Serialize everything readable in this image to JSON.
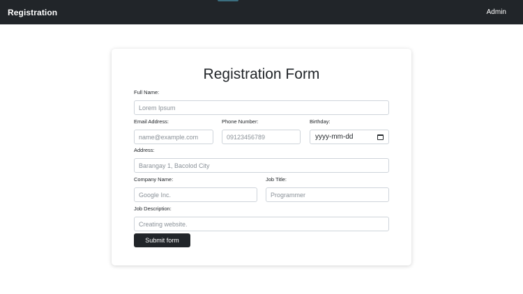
{
  "navbar": {
    "brand": "Registration",
    "admin_link": "Admin"
  },
  "form": {
    "title": "Registration Form",
    "full_name": {
      "label": "Full Name:",
      "placeholder": "Lorem Ipsum"
    },
    "email": {
      "label": "Email Address:",
      "placeholder": "name@example.com"
    },
    "phone": {
      "label": "Phone Number:",
      "placeholder": "09123456789"
    },
    "birthday": {
      "label": "Birthday:",
      "value": "yyyy-mm-dd",
      "icon": "calendar-icon"
    },
    "address": {
      "label": "Address:",
      "placeholder": "Barangay 1, Bacolod City"
    },
    "company": {
      "label": "Company Name:",
      "placeholder": "Google Inc."
    },
    "job_title": {
      "label": "Job Title:",
      "placeholder": "Programmer"
    },
    "job_description": {
      "label": "Job Description:",
      "placeholder": "Creating website."
    },
    "submit_label": "Submit form"
  },
  "colors": {
    "navbar": "#212529",
    "button": "#212529",
    "accent": "#3b6e7f"
  }
}
